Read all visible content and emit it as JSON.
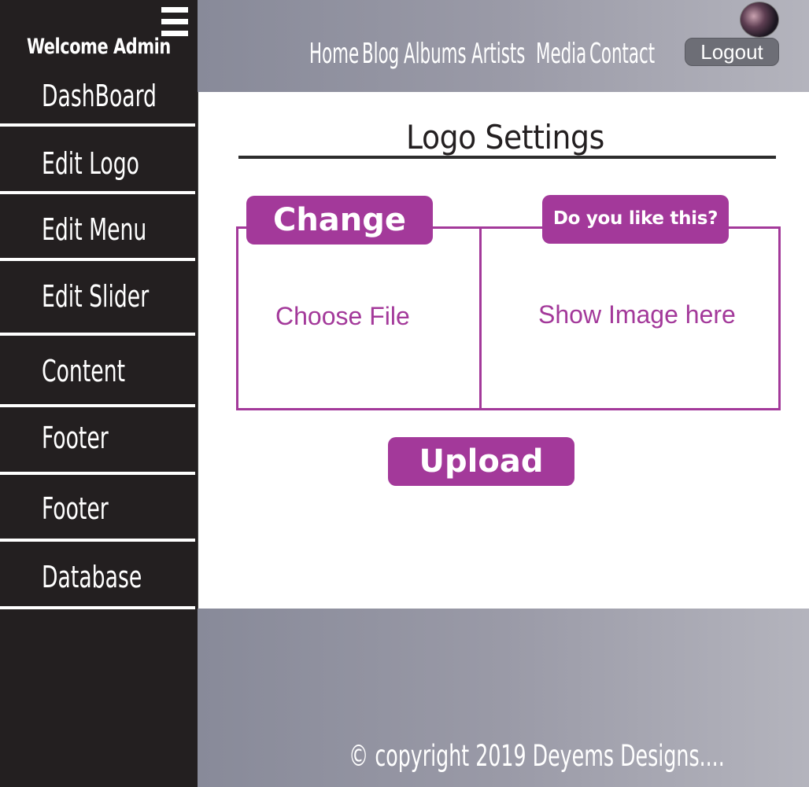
{
  "sidebar": {
    "welcome": "Welcome Admin",
    "items": [
      {
        "label": "DashBoard"
      },
      {
        "label": "Edit Logo"
      },
      {
        "label": "Edit Menu"
      },
      {
        "label": "Edit Slider"
      },
      {
        "label": "Content"
      },
      {
        "label": "Footer"
      },
      {
        "label": "Footer"
      },
      {
        "label": "Database"
      }
    ]
  },
  "header": {
    "nav": [
      "Home",
      "Blog",
      "Albums",
      "Artists",
      "Media",
      "Contact"
    ],
    "logout_label": "Logout"
  },
  "main": {
    "title": "Logo Settings",
    "change_label": "Change",
    "choose_file_label": "Choose File",
    "preview_label": "Do you like this?",
    "preview_text": "Show Image here",
    "upload_label": "Upload"
  },
  "footer": {
    "copyright": "© copyright 2019 Deyems Designs...."
  },
  "colors": {
    "sidebar_bg": "#231f20",
    "accent": "#a3399a",
    "header_gradient_start": "#888a99",
    "header_gradient_end": "#b4b4bd"
  }
}
